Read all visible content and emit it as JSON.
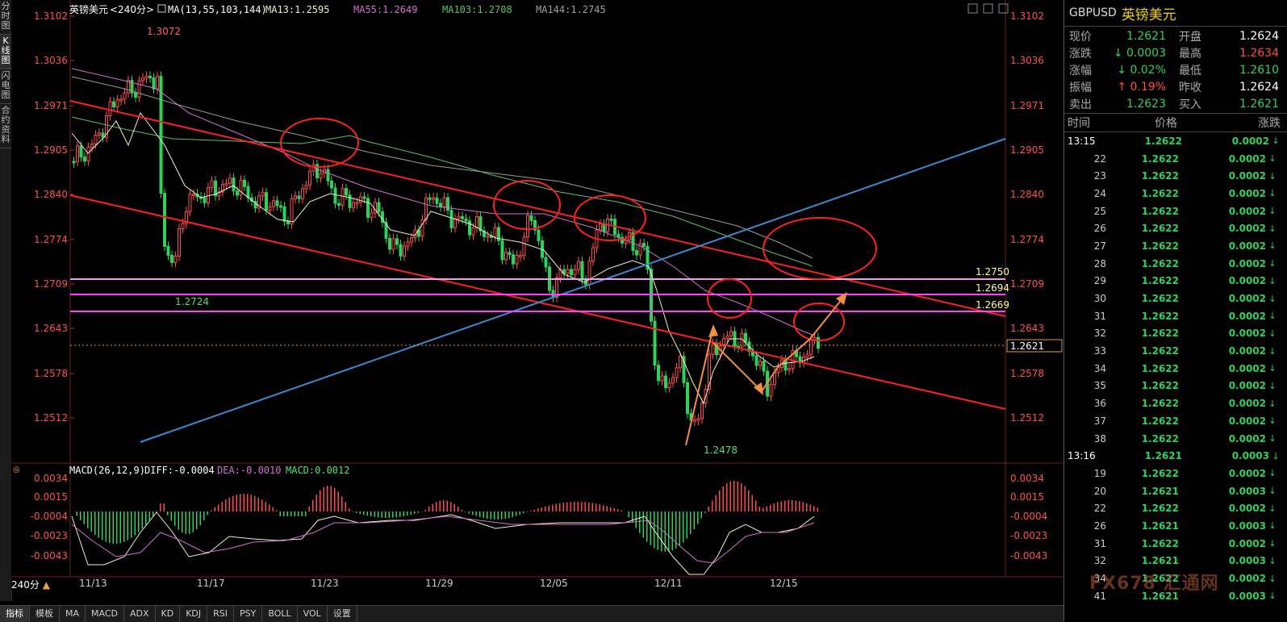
{
  "left_tabs": [
    "分时图",
    "K线图",
    "闪电图",
    "合约资料"
  ],
  "chart_header": {
    "instrument": "英镑美元",
    "period": "<240分>",
    "ma_label": "MA(13,55,103,144)",
    "ma13": "MA13:1.2595",
    "ma55": "MA55:1.2649",
    "ma103": "MA103:1.2708",
    "ma144": "MA144:1.2745"
  },
  "price_axis": [
    "1.3102",
    "1.3036",
    "1.2971",
    "1.2905",
    "1.2840",
    "1.2774",
    "1.2709",
    "1.2643",
    "1.2578",
    "1.2512"
  ],
  "current_price_tag": "1.2621",
  "annotations": {
    "high": "1.3072",
    "low_left": "1.2724",
    "low": "1.2478",
    "line_1": "1.2750",
    "line_2": "1.2694",
    "line_3": "1.2669"
  },
  "macd_header": {
    "label": "MACD(26,12,9)",
    "diff": "DIFF:-0.0004",
    "dea": "DEA:-0.0010",
    "macd": "MACD:0.0012"
  },
  "macd_axis": [
    "0.0034",
    "0.0015",
    "-0.0004",
    "-0.0023",
    "-0.0043"
  ],
  "date_axis": [
    "11/13",
    "11/17",
    "11/23",
    "11/29",
    "12/05",
    "12/11",
    "12/15"
  ],
  "period_button": "240分",
  "bottom_tabs": [
    "指标",
    "模板",
    "MA",
    "MACD",
    "ADX",
    "KD",
    "KDJ",
    "RSI",
    "PSY",
    "BOLL",
    "VOL",
    "设置"
  ],
  "quote": {
    "symbol": "GBPUSD",
    "name": "英镑美元",
    "rows": [
      {
        "l1": "现价",
        "v1": "1.2621",
        "c1": "green",
        "l2": "开盘",
        "v2": "1.2624",
        "c2": "white"
      },
      {
        "l1": "涨跌",
        "v1": "0.0003",
        "c1": "green",
        "arrow1": "down",
        "l2": "最高",
        "v2": "1.2634",
        "c2": "red"
      },
      {
        "l1": "涨幅",
        "v1": "0.02%",
        "c1": "green",
        "arrow1": "down",
        "l2": "最低",
        "v2": "1.2610",
        "c2": "green"
      },
      {
        "l1": "振幅",
        "v1": "0.19%",
        "c1": "red",
        "arrow1": "up",
        "l2": "昨收",
        "v2": "1.2624",
        "c2": "white"
      },
      {
        "l1": "卖出",
        "v1": "1.2623",
        "c1": "green",
        "l2": "买入",
        "v2": "1.2621",
        "c2": "green"
      }
    ],
    "ticks_header": [
      "时间",
      "价格",
      "涨跌"
    ],
    "ticks": [
      {
        "t": "13:15",
        "p": "1.2622",
        "c": "0.0002"
      },
      {
        "t": "22",
        "p": "1.2622",
        "c": "0.0002"
      },
      {
        "t": "23",
        "p": "1.2622",
        "c": "0.0002"
      },
      {
        "t": "24",
        "p": "1.2622",
        "c": "0.0002"
      },
      {
        "t": "25",
        "p": "1.2622",
        "c": "0.0002"
      },
      {
        "t": "26",
        "p": "1.2622",
        "c": "0.0002"
      },
      {
        "t": "27",
        "p": "1.2622",
        "c": "0.0002"
      },
      {
        "t": "28",
        "p": "1.2622",
        "c": "0.0002"
      },
      {
        "t": "29",
        "p": "1.2622",
        "c": "0.0002"
      },
      {
        "t": "30",
        "p": "1.2622",
        "c": "0.0002"
      },
      {
        "t": "31",
        "p": "1.2622",
        "c": "0.0002"
      },
      {
        "t": "32",
        "p": "1.2622",
        "c": "0.0002"
      },
      {
        "t": "33",
        "p": "1.2622",
        "c": "0.0002"
      },
      {
        "t": "34",
        "p": "1.2622",
        "c": "0.0002"
      },
      {
        "t": "35",
        "p": "1.2622",
        "c": "0.0002"
      },
      {
        "t": "36",
        "p": "1.2622",
        "c": "0.0002"
      },
      {
        "t": "37",
        "p": "1.2622",
        "c": "0.0002"
      },
      {
        "t": "38",
        "p": "1.2622",
        "c": "0.0002"
      },
      {
        "t": "13:16",
        "p": "1.2621",
        "c": "0.0003"
      },
      {
        "t": "19",
        "p": "1.2622",
        "c": "0.0002"
      },
      {
        "t": "20",
        "p": "1.2621",
        "c": "0.0003"
      },
      {
        "t": "22",
        "p": "1.2622",
        "c": "0.0002"
      },
      {
        "t": "26",
        "p": "1.2621",
        "c": "0.0003"
      },
      {
        "t": "31",
        "p": "1.2622",
        "c": "0.0002"
      },
      {
        "t": "32",
        "p": "1.2621",
        "c": "0.0003"
      },
      {
        "t": "34",
        "p": "1.2622",
        "c": "0.0002"
      },
      {
        "t": "41",
        "p": "1.2621",
        "c": "0.0003"
      }
    ]
  },
  "watermark": "FX678 汇通网",
  "colors": {
    "up": "#ff4b4b",
    "down": "#2ed15a",
    "accent": "#f2d400",
    "ma13": "#f0f0c8",
    "ma55": "#d070d0",
    "ma103": "#60c060",
    "ma144": "#a0a0a0",
    "channel": "#ff2020",
    "trend": "#3a8ad0",
    "level": "#ff40ff",
    "arrow": "#f09040"
  }
}
